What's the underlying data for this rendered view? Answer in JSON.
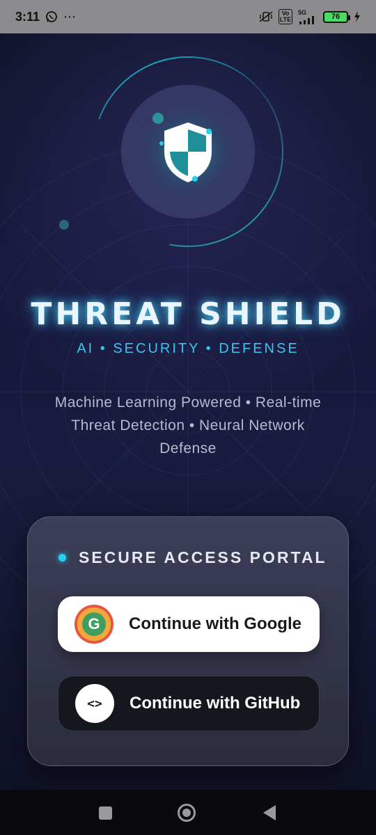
{
  "status_bar": {
    "time": "3:11",
    "whatsapp_icon": "whatsapp-icon",
    "more_icon": "⋯",
    "network": "5G",
    "volte": "Vo LTE",
    "battery": "76"
  },
  "hero": {
    "icon": "shield-icon",
    "accent_color": "#22d3ee"
  },
  "app": {
    "title": "THREAT SHIELD",
    "tagline": "AI • SECURITY • DEFENSE",
    "description": "Machine Learning Powered • Real-time Threat Detection • Neural Network Defense"
  },
  "auth_card": {
    "heading": "SECURE ACCESS PORTAL",
    "google_button": {
      "label": "Continue with Google",
      "icon_letter": "G",
      "icon": "google-icon"
    },
    "github_button": {
      "label": "Continue with GitHub",
      "icon_glyph": "<>",
      "icon": "code-icon"
    }
  },
  "nav_bar": {
    "recents": "recents-icon",
    "home": "home-icon",
    "back": "back-icon"
  }
}
